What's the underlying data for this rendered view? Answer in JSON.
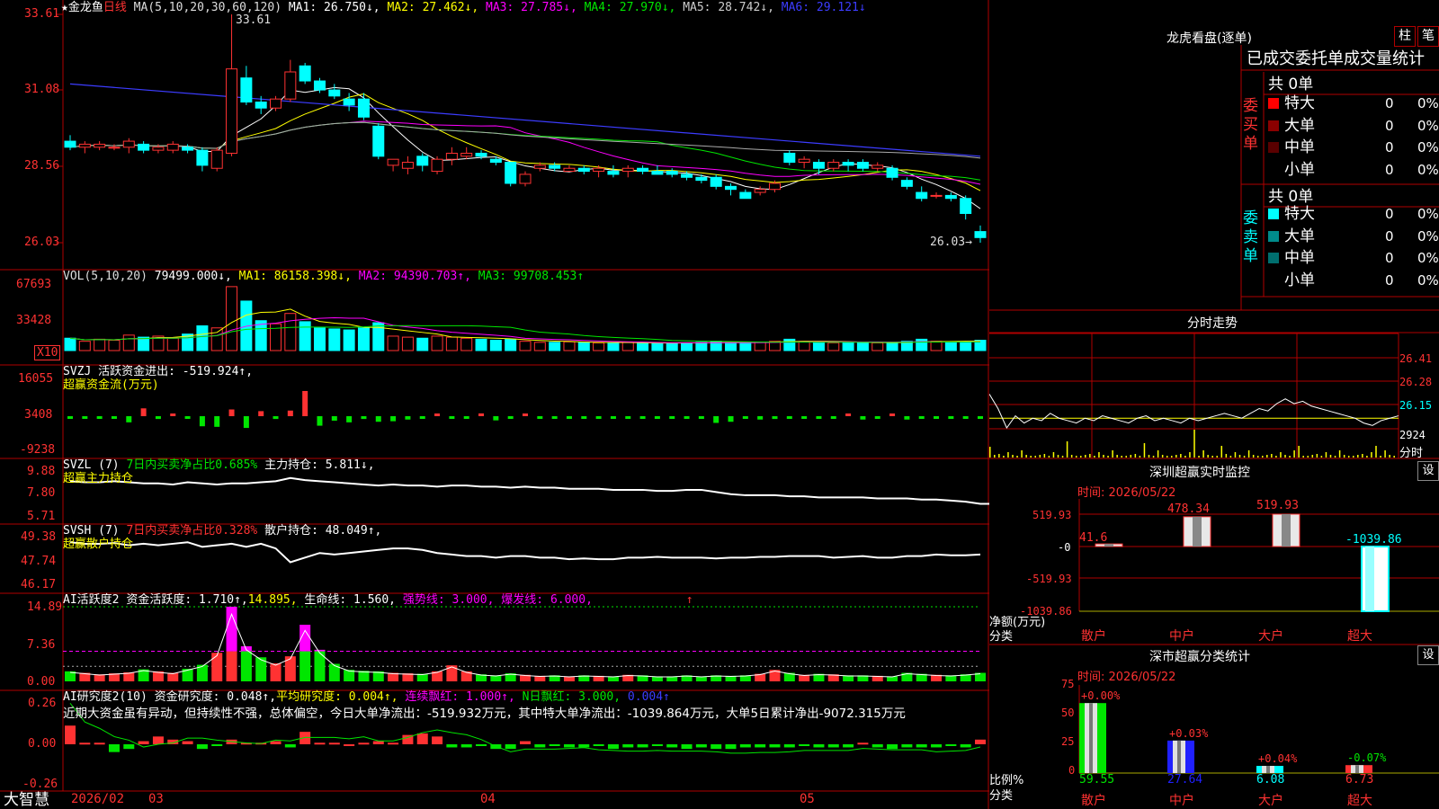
{
  "colors": {
    "up": "#ff3232",
    "down": "#00ffff",
    "vol_up": "#ff3232",
    "bg": "#000000",
    "grid": "#b00000",
    "white": "#ffffff",
    "yellow": "#ffff00",
    "magenta": "#ff00ff",
    "green": "#00e600",
    "blue": "#3c3cff"
  },
  "header": {
    "stock": "★金龙鱼",
    "period": "日线",
    "ma_def": "MA(5,10,20,30,60,120)",
    "ma1": "MA1: 26.750↓,",
    "ma2": "MA2: 27.462↓,",
    "ma3": "MA3: 27.785↓,",
    "ma4": "MA4: 27.970↓,",
    "ma5": "MA5: 28.742↓,",
    "ma6": "MA6: 29.121↓",
    "high_label": "33.61",
    "low_label": "26.03→"
  },
  "price_axis": [
    "33.61",
    "31.08",
    "28.56",
    "26.03"
  ],
  "vol": {
    "def": "VOL(5,10,20)",
    "v": "79499.000↓,",
    "ma1": "MA1: 86158.398↓,",
    "ma2": "MA2: 94390.703↑,",
    "ma3": "MA3: 99708.453↑",
    "axis": [
      "67693",
      "33428"
    ],
    "unit": "X10"
  },
  "svzj": {
    "name": "SVZJ",
    "desc": "活跃资金进出: -519.924↑,",
    "sub": "超赢资金流(万元)",
    "axis": [
      "16055",
      "3408",
      "-9238"
    ]
  },
  "svzl": {
    "name": "SVZL (7)",
    "desc": "7日内买卖净占比0.685%",
    "val": "主力持仓: 5.811↓,",
    "sub": "超赢主力持仓",
    "axis": [
      "9.88",
      "7.80",
      "5.71"
    ]
  },
  "svsh": {
    "name": "SVSH (7)",
    "desc": "7日内买卖净占比0.328%",
    "val": "散户持仓: 48.049↑,",
    "sub": "超赢散户持仓",
    "axis": [
      "49.38",
      "47.74",
      "46.17"
    ]
  },
  "ai1": {
    "name": "AI活跃度2",
    "a": "资金活跃度: 1.710↑,",
    "b": "14.895,",
    "c": "生命线: 1.560,",
    "d": "强势线: 3.000,",
    "e": "爆发线: 6.000,",
    "f": "↑",
    "axis": [
      "14.89",
      "7.36",
      "0.00"
    ]
  },
  "ai2": {
    "name": "AI研究度2(10)",
    "a": "资金研究度: 0.048↑,",
    "b": "平均研究度: 0.004↑,",
    "c": "连续飘红: 1.000↑,",
    "d": "N日飘红: 3.000,",
    "e": "0.004↑",
    "note": "近期大资金虽有异动，但持续性不强，总体偏空，今日大单净流出：-519.932万元，其中特大单净流出：-1039.864万元，大单5日累计净出-9072.315万元",
    "axis": [
      "0.26",
      "0.00",
      "-0.26"
    ]
  },
  "xaxis": {
    "brand": "大智慧",
    "d1": "2026/02",
    "d2": "03",
    "d3": "04",
    "d4": "05"
  },
  "lhb": {
    "title": "龙虎看盘(逐单)",
    "btn1": "柱",
    "btn2": "笔",
    "heading": "已成交委托单成交量统计",
    "buy": {
      "label": "委买单",
      "total": "共 0单",
      "rows": [
        {
          "name": "特大",
          "v": "0",
          "p": "0%",
          "c": "#ff0000"
        },
        {
          "name": "大单",
          "v": "0",
          "p": "0%",
          "c": "#8b0000"
        },
        {
          "name": "中单",
          "v": "0",
          "p": "0%",
          "c": "#5a0000"
        },
        {
          "name": "小单",
          "v": "0",
          "p": "0%",
          "c": "#000000"
        }
      ]
    },
    "sell": {
      "label": "委卖单",
      "total": "共 0单",
      "rows": [
        {
          "name": "特大",
          "v": "0",
          "p": "0%",
          "c": "#00ffff"
        },
        {
          "name": "大单",
          "v": "0",
          "p": "0%",
          "c": "#008b8b"
        },
        {
          "name": "中单",
          "v": "0",
          "p": "0%",
          "c": "#006e6e"
        },
        {
          "name": "小单",
          "v": "0",
          "p": "0%",
          "c": "#000000"
        }
      ]
    }
  },
  "intraday": {
    "title": "分时走势",
    "axis": [
      "26.41",
      "26.28",
      "26.15",
      "2924"
    ],
    "unit": "分时"
  },
  "monitor": {
    "title": "深圳超赢实时监控",
    "btn": "设",
    "time": "时间: 2026/05/22",
    "axis": [
      "519.93",
      "-0",
      "-519.93",
      "-1039.86"
    ],
    "ylabel": "净额(万元)",
    "xlabel": "分类",
    "cats": [
      "散户",
      "中户",
      "大户",
      "超大"
    ],
    "values": [
      41.6,
      478.34,
      519.93,
      -1039.86
    ],
    "labels": [
      "41.6",
      "478.34",
      "519.93",
      "-1039.86"
    ]
  },
  "classify": {
    "title": "深市超赢分类统计",
    "btn": "设",
    "time": "时间: 2026/05/22",
    "axis": [
      "75",
      "50",
      "25",
      "0"
    ],
    "ylabel": "比例%",
    "xlabel": "分类",
    "cats": [
      "散户",
      "中户",
      "大户",
      "超大"
    ],
    "values": [
      59.55,
      27.64,
      6.08,
      6.73
    ],
    "changes": [
      "+0.00%",
      "+0.03%",
      "+0.04%",
      "-0.07%"
    ],
    "labels": [
      "59.55",
      "27.64",
      "6.08",
      "6.73"
    ]
  },
  "chart_data": {
    "type": "candlestick",
    "title": "",
    "price_range": [
      26.03,
      33.61
    ],
    "series_note": "",
    "candles": [
      [
        29.4,
        29.6,
        29.1,
        29.2
      ],
      [
        29.2,
        29.4,
        29.0,
        29.3
      ],
      [
        29.2,
        29.4,
        29.1,
        29.3
      ],
      [
        29.2,
        29.3,
        29.1,
        29.2
      ],
      [
        29.2,
        29.5,
        29.0,
        29.4
      ],
      [
        29.3,
        29.4,
        29.0,
        29.1
      ],
      [
        29.1,
        29.3,
        29.0,
        29.2
      ],
      [
        29.1,
        29.4,
        29.0,
        29.3
      ],
      [
        29.2,
        29.3,
        29.0,
        29.1
      ],
      [
        29.1,
        29.2,
        28.4,
        28.6
      ],
      [
        28.5,
        29.2,
        28.4,
        29.1
      ],
      [
        29.0,
        33.61,
        28.9,
        31.8
      ],
      [
        31.5,
        31.9,
        30.6,
        30.7
      ],
      [
        30.7,
        30.9,
        30.3,
        30.5
      ],
      [
        30.5,
        30.9,
        30.4,
        30.8
      ],
      [
        30.8,
        32.1,
        30.7,
        31.7
      ],
      [
        31.9,
        32.0,
        31.3,
        31.4
      ],
      [
        31.4,
        31.5,
        31.0,
        31.1
      ],
      [
        31.1,
        31.3,
        30.8,
        30.9
      ],
      [
        30.8,
        31.0,
        30.4,
        30.6
      ],
      [
        30.8,
        31.0,
        30.1,
        30.2
      ],
      [
        29.9,
        30.0,
        28.8,
        28.9
      ],
      [
        28.6,
        28.8,
        28.4,
        28.8
      ],
      [
        28.5,
        28.9,
        28.3,
        28.7
      ],
      [
        28.9,
        29.0,
        28.4,
        28.6
      ],
      [
        28.4,
        28.9,
        28.3,
        28.8
      ],
      [
        28.8,
        29.2,
        28.6,
        29.0
      ],
      [
        28.9,
        29.2,
        28.8,
        29.0
      ],
      [
        29.0,
        29.1,
        28.8,
        28.9
      ],
      [
        28.8,
        28.9,
        28.6,
        28.7
      ],
      [
        28.7,
        28.7,
        27.9,
        28.0
      ],
      [
        28.0,
        28.4,
        27.9,
        28.3
      ],
      [
        28.5,
        28.7,
        28.4,
        28.6
      ],
      [
        28.6,
        28.7,
        28.4,
        28.5
      ],
      [
        28.4,
        28.6,
        28.4,
        28.5
      ],
      [
        28.5,
        28.6,
        28.3,
        28.4
      ],
      [
        28.4,
        28.6,
        28.2,
        28.5
      ],
      [
        28.4,
        28.6,
        28.2,
        28.3
      ],
      [
        28.4,
        28.6,
        28.2,
        28.5
      ],
      [
        28.5,
        28.6,
        28.3,
        28.4
      ],
      [
        28.4,
        28.6,
        28.3,
        28.3
      ],
      [
        28.4,
        28.5,
        28.2,
        28.3
      ],
      [
        28.3,
        28.4,
        28.1,
        28.2
      ],
      [
        28.2,
        28.3,
        28.0,
        28.1
      ],
      [
        28.2,
        28.3,
        27.8,
        27.9
      ],
      [
        27.9,
        28.0,
        27.6,
        27.8
      ],
      [
        27.7,
        27.8,
        27.5,
        27.5
      ],
      [
        27.7,
        27.9,
        27.6,
        27.8
      ],
      [
        27.8,
        28.1,
        27.7,
        28.0
      ],
      [
        29.0,
        29.1,
        28.6,
        28.7
      ],
      [
        28.7,
        28.9,
        28.5,
        28.8
      ],
      [
        28.7,
        28.8,
        28.3,
        28.5
      ],
      [
        28.5,
        28.8,
        28.4,
        28.7
      ],
      [
        28.7,
        28.8,
        28.4,
        28.6
      ],
      [
        28.7,
        28.8,
        28.4,
        28.5
      ],
      [
        28.5,
        28.7,
        28.4,
        28.6
      ],
      [
        28.5,
        28.6,
        28.1,
        28.2
      ],
      [
        28.1,
        28.2,
        27.8,
        27.9
      ],
      [
        27.7,
        27.9,
        27.4,
        27.5
      ],
      [
        27.6,
        27.7,
        27.5,
        27.6
      ],
      [
        27.6,
        27.7,
        27.4,
        27.5
      ],
      [
        27.5,
        27.6,
        26.8,
        27.0
      ],
      [
        26.4,
        26.6,
        26.03,
        26.2
      ]
    ],
    "volumes": [
      12000,
      9000,
      11000,
      10000,
      15000,
      13000,
      14000,
      12000,
      16000,
      24000,
      22000,
      62000,
      48000,
      29000,
      26000,
      36000,
      28000,
      22000,
      21000,
      20000,
      22000,
      27000,
      14000,
      13000,
      12000,
      14000,
      13000,
      12000,
      11000,
      10000,
      11000,
      9000,
      8000,
      8000,
      8500,
      8000,
      7500,
      7000,
      8000,
      7500,
      7000,
      7000,
      7500,
      8000,
      9000,
      8000,
      7500,
      8000,
      9000,
      11000,
      9000,
      8000,
      7500,
      8000,
      8000,
      7500,
      7000,
      9000,
      11000,
      9000,
      8000,
      8500,
      10000
    ],
    "svzj": [
      -500,
      -400,
      -500,
      -900,
      -2200,
      2800,
      -1000,
      600,
      -400,
      -3600,
      -3800,
      2400,
      -4200,
      1800,
      -1000,
      2000,
      9000,
      -3400,
      -1600,
      -2200,
      -1000,
      -2000,
      -1800,
      -1200,
      -500,
      600,
      -400,
      -300,
      1000,
      -1500,
      -600,
      300,
      -600,
      -400,
      -600,
      -500,
      -400,
      -600,
      -500,
      -600,
      -700,
      -400,
      -500,
      -600,
      -2400,
      -2000,
      -800,
      -1200,
      -1000,
      -800,
      -800,
      -700,
      -600,
      500,
      -1200,
      -300,
      500,
      -1200,
      -700,
      -600,
      -900,
      -600,
      -400
    ],
    "svzl": [
      8.6,
      8.5,
      8.5,
      8.6,
      8.5,
      8.4,
      8.4,
      8.3,
      8.5,
      8.4,
      8.3,
      8.4,
      8.4,
      8.5,
      8.6,
      8.9,
      8.7,
      8.6,
      8.5,
      8.4,
      8.3,
      8.2,
      8.3,
      8.2,
      8.2,
      8.1,
      8.2,
      8.2,
      8.1,
      8.1,
      8.0,
      8.1,
      8.0,
      8.0,
      7.9,
      7.9,
      7.9,
      7.8,
      7.8,
      7.8,
      7.7,
      7.7,
      7.8,
      7.8,
      7.6,
      7.4,
      7.3,
      7.3,
      7.3,
      7.2,
      7.2,
      7.1,
      7.1,
      7.1,
      7.1,
      7.0,
      7.0,
      7.0,
      6.9,
      6.9,
      6.8,
      6.7,
      6.5,
      6.5
    ],
    "svsh": [
      48.9,
      48.8,
      48.8,
      48.85,
      48.7,
      48.8,
      48.7,
      48.8,
      48.9,
      48.6,
      48.7,
      48.8,
      48.6,
      48.8,
      48.5,
      47.6,
      47.9,
      48.2,
      48.1,
      48.2,
      48.3,
      48.4,
      48.5,
      48.5,
      48.4,
      48.2,
      48.1,
      48.0,
      48.0,
      47.9,
      48.0,
      48.0,
      47.9,
      47.9,
      47.8,
      47.85,
      47.8,
      47.8,
      47.9,
      47.9,
      47.95,
      47.9,
      47.9,
      47.9,
      47.85,
      47.9,
      47.9,
      47.95,
      47.95,
      48.0,
      48.0,
      48.0,
      47.9,
      47.95,
      48.0,
      47.9,
      47.9,
      48.0,
      48.0,
      48.1,
      48.05,
      48.05,
      48.1
    ],
    "ai1": [
      2.0,
      1.7,
      1.4,
      1.6,
      1.8,
      2.4,
      2.0,
      1.7,
      2.5,
      3.3,
      5.7,
      14.9,
      7.0,
      4.8,
      3.6,
      5.0,
      11.3,
      6.3,
      3.5,
      2.3,
      2.1,
      2.0,
      1.7,
      1.6,
      1.5,
      2.0,
      3.2,
      2.0,
      1.4,
      1.2,
      1.6,
      1.3,
      1.1,
      1.2,
      1.0,
      1.2,
      1.1,
      1.0,
      1.3,
      1.2,
      1.0,
      1.0,
      1.2,
      1.0,
      1.2,
      1.1,
      1.2,
      1.5,
      2.3,
      1.7,
      1.3,
      1.5,
      1.4,
      1.2,
      1.2,
      1.1,
      1.0,
      1.7,
      1.5,
      1.3,
      1.2,
      1.4,
      1.7
    ],
    "ai2": [
      0.12,
      0.01,
      0.01,
      -0.05,
      -0.03,
      0.02,
      0.05,
      0.03,
      0.02,
      -0.03,
      -0.01,
      0.03,
      0.01,
      0.01,
      0.02,
      -0.02,
      0.08,
      0.01,
      0.01,
      0.0,
      0.01,
      0.02,
      0.01,
      0.06,
      0.07,
      0.05,
      -0.02,
      -0.02,
      -0.01,
      -0.03,
      -0.03,
      0.02,
      -0.02,
      -0.01,
      -0.02,
      -0.02,
      -0.01,
      -0.03,
      -0.02,
      -0.02,
      -0.01,
      -0.02,
      -0.03,
      -0.02,
      -0.03,
      -0.03,
      -0.02,
      -0.02,
      -0.02,
      -0.02,
      -0.01,
      -0.02,
      -0.02,
      -0.02,
      0.01,
      -0.02,
      -0.03,
      -0.02,
      -0.02,
      -0.02,
      -0.01,
      -0.02,
      0.03
    ],
    "intraday": [
      26.26,
      26.2,
      26.12,
      26.17,
      26.14,
      26.16,
      26.15,
      26.18,
      26.16,
      26.15,
      26.14,
      26.16,
      26.15,
      26.17,
      26.16,
      26.15,
      26.14,
      26.16,
      26.17,
      26.15,
      26.16,
      26.15,
      26.14,
      26.16,
      26.15,
      26.16,
      26.17,
      26.18,
      26.17,
      26.16,
      26.18,
      26.2,
      26.19,
      26.22,
      26.24,
      26.22,
      26.23,
      26.21,
      26.2,
      26.19,
      26.18,
      26.17,
      26.16,
      26.14,
      26.13,
      26.15,
      26.16,
      26.17
    ]
  }
}
